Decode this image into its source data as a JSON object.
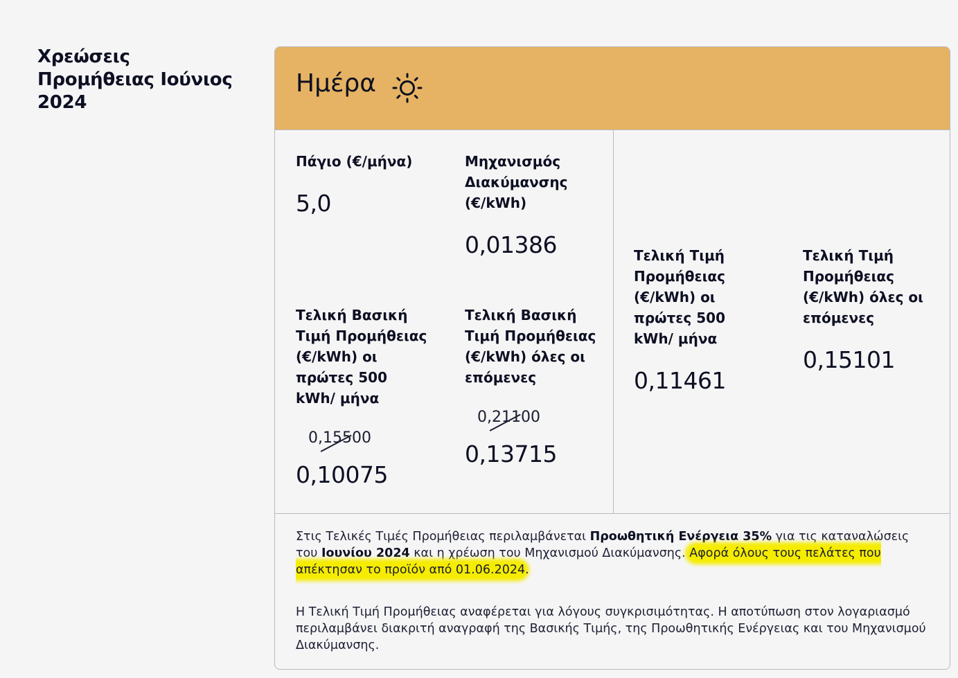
{
  "side_title": "Χρεώσεις Προμήθειας Ιούνιος 2024",
  "header": {
    "title": "Ημέρα",
    "icon": "sun-icon",
    "color": "#e5b363"
  },
  "fields": {
    "pagio_label": "Πάγιο (€/μήνα)",
    "pagio_value": "5,0",
    "mech_label": "Μηχανισμός Διακύμανσης (€/kWh)",
    "mech_value": "0,01386",
    "base_first_label": "Τελική Βασική Τιμή Προμήθειας (€/kWh) οι πρώτες 500 kWh/ μήνα",
    "base_first_old": "0,15500",
    "base_first_value": "0,10075",
    "base_next_label": "Τελική Βασική Τιμή Προμήθειας (€/kWh) όλες οι επόμενες",
    "base_next_old": "0,21100",
    "base_next_value": "0,13715",
    "final_first_label": "Τελική Τιμή Προμήθειας (€/kWh) οι πρώτες 500 kWh/ μήνα",
    "final_first_value": "0,11461",
    "final_next_label": "Τελική Τιμή Προμήθειας (€/kWh) όλες οι επόμενες",
    "final_next_value": "0,15101"
  },
  "notes": {
    "p1_a": "Στις Τελικές Τιμές Προμήθειας περιλαμβάνεται ",
    "p1_b": "Προωθητική Ενέργεια 35%",
    "p1_c": " για τις καταναλώσεις του ",
    "p1_d": "Ιουνίου 2024",
    "p1_e": " και η χρέωση του Μηχανισμού Διακύμανσης. ",
    "p1_hl": "Αφορά όλους τους πελάτες που απέκτησαν το προϊόν από 01.06.2024",
    "p1_end": ".",
    "p2": "Η Τελική Τιμή Προμήθειας αναφέρεται για λόγους συγκρισιμότητας. Η αποτύπωση στον λογαριασμό περιλαμβάνει διακριτή αναγραφή της Βασικής Τιμής, της Προωθητικής Ενέργειας και του Μηχανισμού Διακύμανσης."
  },
  "highlight_color": "#f5ec00"
}
